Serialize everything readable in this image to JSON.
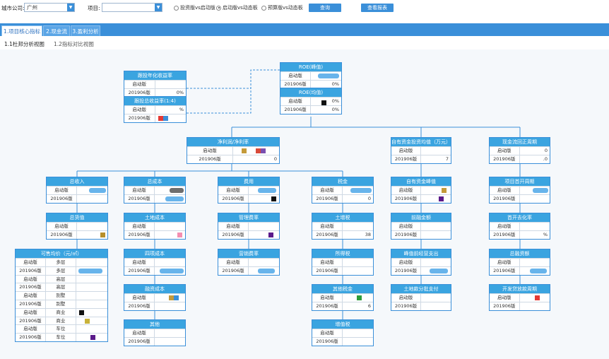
{
  "filters": {
    "city_label": "城市公司:",
    "city_value": "广州",
    "project_label": "项目:",
    "project_value": "",
    "radios": [
      "投资版vs启动版",
      "启动版vs动态板",
      "预算版vs动态板"
    ],
    "selected_radio": 1,
    "query_btn": "查询",
    "report_btn": "查看报表"
  },
  "tabs": [
    "1.项目核心指标",
    "2.现金流",
    "3.盈利分析"
  ],
  "subtabs": [
    "1.1杜邦分析视图",
    "1.2指标对比视图"
  ],
  "rowlabels": {
    "a": "启动版",
    "b": "201906版"
  },
  "nodes": {
    "roe_peak": {
      "title": "ROE(峰值)",
      "v2": "0%"
    },
    "roe_avg": {
      "title": "ROE(均值)",
      "v1": "0%",
      "v2": "0%"
    },
    "annual_return": {
      "title": "跟投年化收益率",
      "v1": "",
      "v2": "0%"
    },
    "total_return": {
      "title": "跟投总收益率(1:4)",
      "v1": "%",
      "v2": ""
    },
    "net_margin": {
      "title": "净利润/净利率",
      "v1": "00",
      "v2": "0"
    },
    "equity_avg": {
      "title": "自有资金投资均值（万元）",
      "v1": "",
      "v2": "7"
    },
    "cash_cycle": {
      "title": "现金流回正周期",
      "v1": "0",
      "v2": ".0"
    },
    "revenue": {
      "title": "总收入",
      "v1": "",
      "v2": ""
    },
    "cost": {
      "title": "总成本",
      "v1": "",
      "v2": ""
    },
    "expense": {
      "title": "费用",
      "v1": "",
      "v2": ""
    },
    "tax": {
      "title": "税金",
      "v1": "",
      "v2": "0"
    },
    "equity_peak": {
      "title": "自有资金峰值",
      "v1": "",
      "v2": ""
    },
    "open_cycle": {
      "title": "项目首开周期",
      "v1": "",
      "v2": ""
    },
    "total_value": {
      "title": "总货值",
      "v1": "",
      "v2": ""
    },
    "land_cost": {
      "title": "土地成本",
      "v1": "",
      "v2": ""
    },
    "mgmt_rate": {
      "title": "管理费率",
      "v1": "",
      "v2": ""
    },
    "land_vat": {
      "title": "土增税",
      "v1": "",
      "v2": "38"
    },
    "pre_finance": {
      "title": "前融金额",
      "v1": "",
      "v2": ""
    },
    "first_sale_rate": {
      "title": "首开去化率",
      "v1": "",
      "v2": "%"
    },
    "four_cost": {
      "title": "四项成本",
      "v1": "",
      "v2": ""
    },
    "sales_rate": {
      "title": "营销费率",
      "v1": "",
      "v2": ""
    },
    "income_tax": {
      "title": "所得税",
      "v1": "",
      "v2": ""
    },
    "peak_opex": {
      "title": "峰值前经营支出",
      "v1": "",
      "v2": ""
    },
    "total_finance": {
      "title": "总融资额",
      "v1": "",
      "v2": ""
    },
    "finance_cost": {
      "title": "融资成本",
      "v1": "",
      "v2": ""
    },
    "other_tax": {
      "title": "其他税金",
      "v1": "",
      "v2": "6"
    },
    "land_installment": {
      "title": "土地款分批支付",
      "v1": "",
      "v2": ""
    },
    "loan_cycle": {
      "title": "开发贷放款周期",
      "v1": "",
      "v2": ""
    },
    "other": {
      "title": "其他",
      "v1": "",
      "v2": ""
    },
    "stamp_tax": {
      "title": "增值税",
      "v1": "",
      "v2": ""
    }
  },
  "price_table": {
    "title": "可售均价（元/㎡）",
    "rows": [
      [
        "启动版",
        "多层"
      ],
      [
        "201906版",
        "多层"
      ],
      [
        "启动版",
        "高层"
      ],
      [
        "201906版",
        "高层"
      ],
      [
        "启动版",
        "别墅"
      ],
      [
        "201906版",
        "别墅"
      ],
      [
        "启动版",
        "商业"
      ],
      [
        "201906版",
        "商业"
      ],
      [
        "启动版",
        "车位"
      ],
      [
        "201906版",
        "车位"
      ]
    ]
  },
  "colors": {
    "accent": "#3a8fd9",
    "header": "#3aa4e0"
  }
}
